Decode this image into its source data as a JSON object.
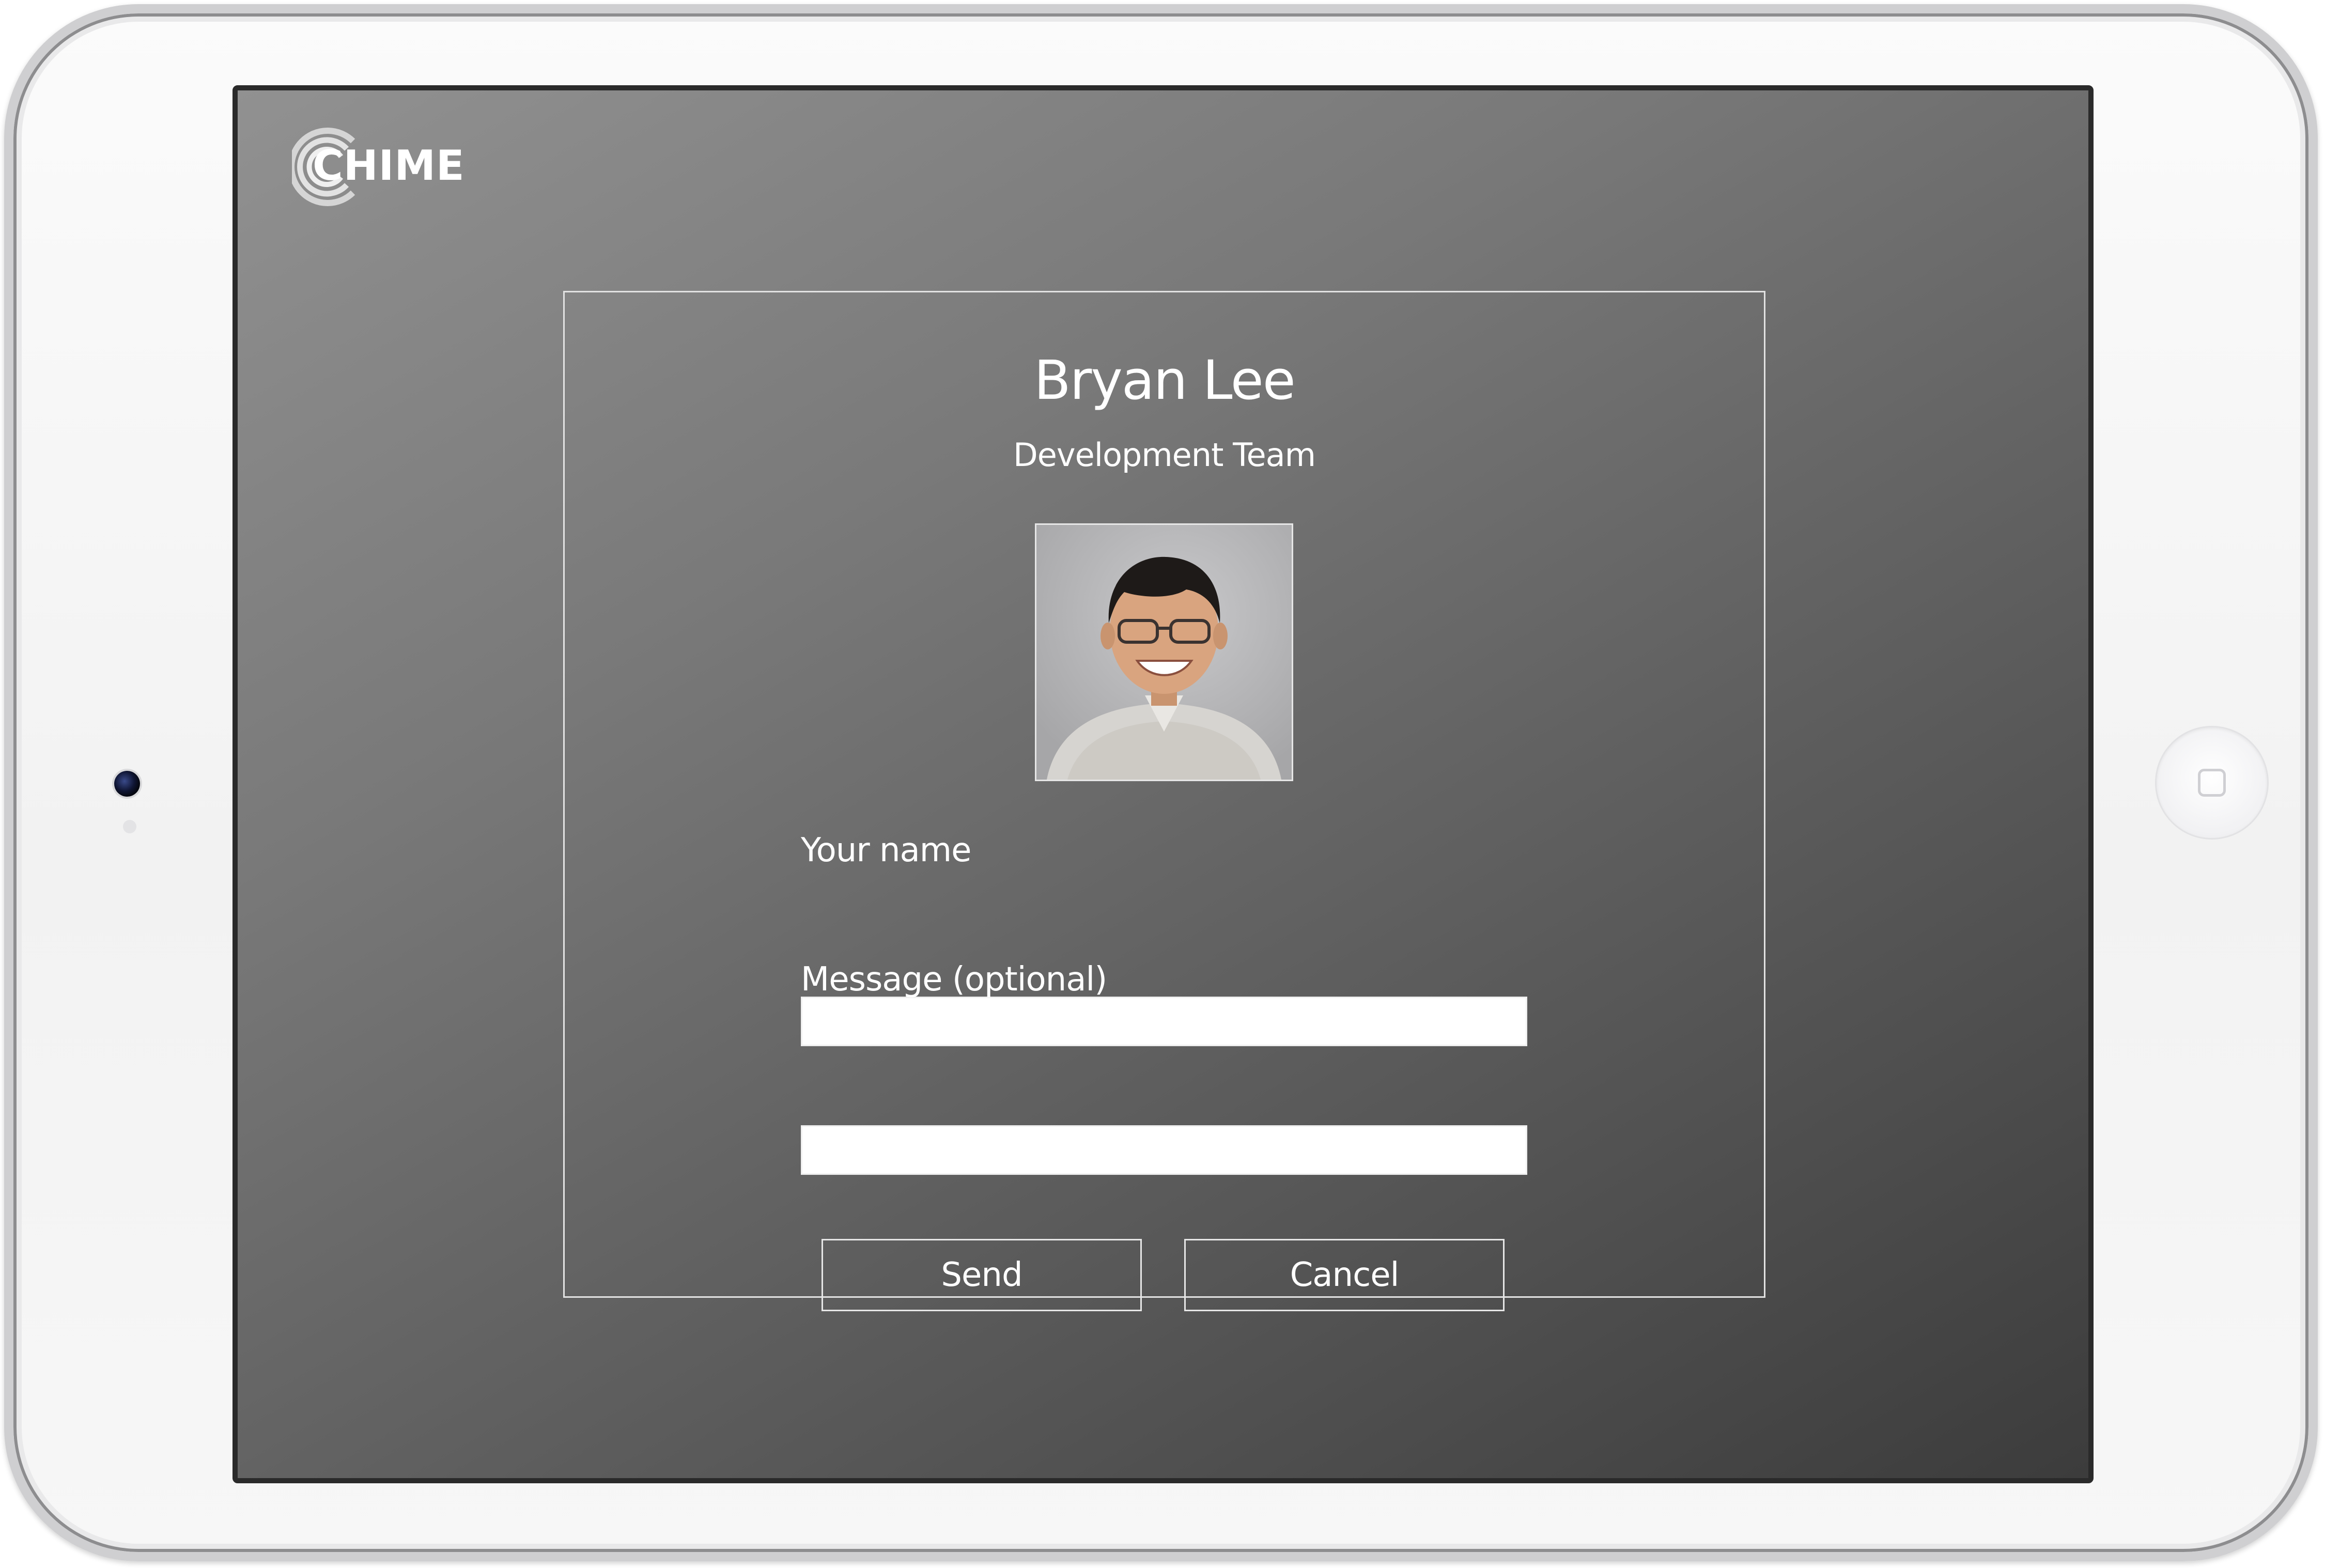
{
  "app": {
    "logo_text": "CHIME"
  },
  "contact": {
    "name": "Bryan Lee",
    "team": "Development Team",
    "photo": "profile-photo"
  },
  "form": {
    "name_label": "Your name",
    "name_value": "",
    "message_label": "Message (optional)",
    "message_value": ""
  },
  "actions": {
    "send_label": "Send",
    "cancel_label": "Cancel"
  },
  "colors": {
    "screen_gradient_start": "#919191",
    "screen_gradient_end": "#3c3c3c",
    "text": "#ffffff",
    "panel_border": "#e2e2e2"
  }
}
